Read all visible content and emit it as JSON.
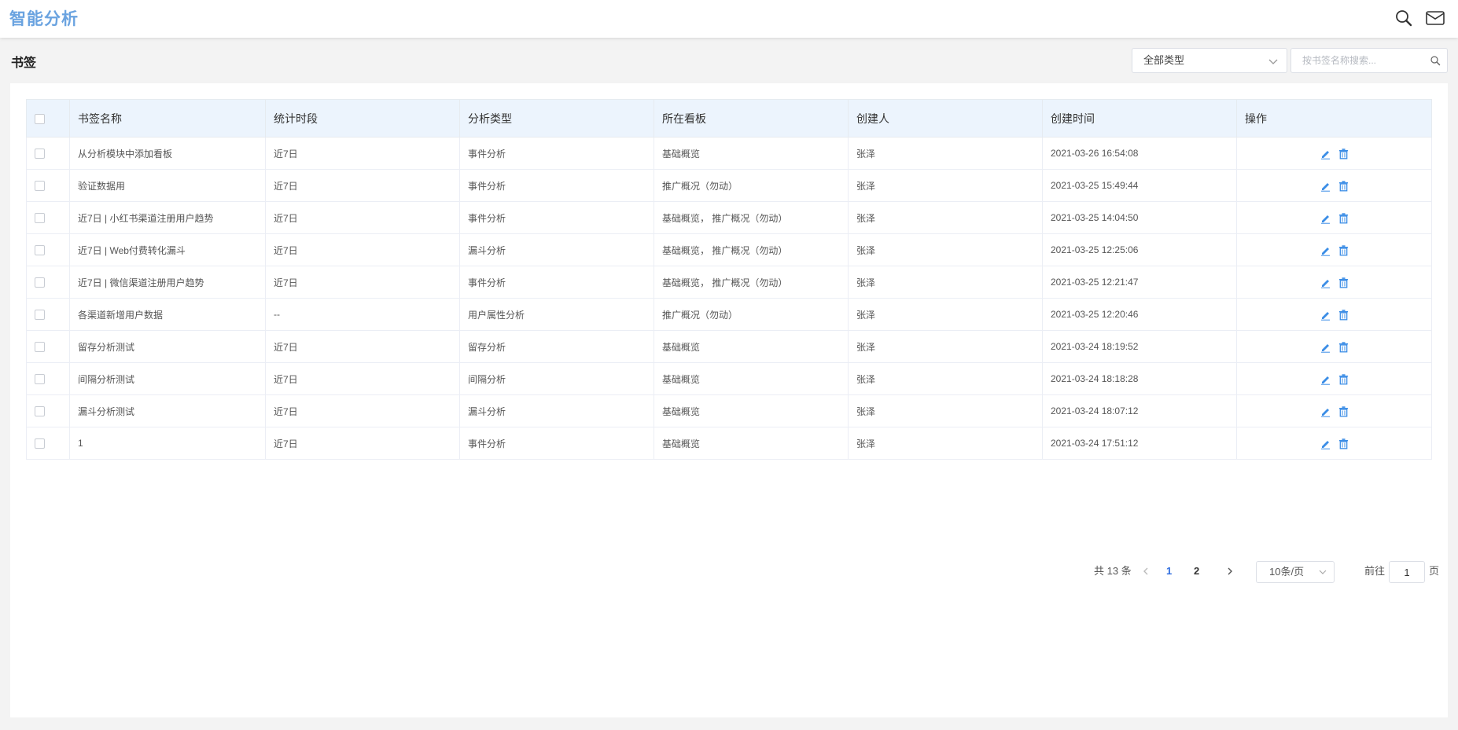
{
  "app": {
    "title": "智能分析"
  },
  "header_icons": [
    "search-icon",
    "mail-icon"
  ],
  "page": {
    "title": "书签"
  },
  "filters": {
    "type_select": {
      "selected": "全部类型",
      "chevron_icon": "chevron-down-icon"
    },
    "search": {
      "placeholder": "按书签名称搜索...",
      "value": "",
      "icon": "search-icon"
    }
  },
  "table": {
    "columns": [
      "",
      "书签名称",
      "统计时段",
      "分析类型",
      "所在看板",
      "创建人",
      "创建时间",
      "操作"
    ],
    "row_actions": [
      "edit-icon",
      "delete-icon"
    ],
    "rows": [
      {
        "name": "从分析模块中添加看板",
        "period": "近7日",
        "type": "事件分析",
        "board": "基础概览",
        "creator": "张泽",
        "created": "2021-03-26 16:54:08"
      },
      {
        "name": "验证数据用",
        "period": "近7日",
        "type": "事件分析",
        "board": "推广概况（勿动）",
        "creator": "张泽",
        "created": "2021-03-25 15:49:44"
      },
      {
        "name": "近7日 | 小红书渠道注册用户趋势",
        "period": "近7日",
        "type": "事件分析",
        "board": "基础概览， 推广概况（勿动）",
        "creator": "张泽",
        "created": "2021-03-25 14:04:50"
      },
      {
        "name": "近7日 | Web付费转化漏斗",
        "period": "近7日",
        "type": "漏斗分析",
        "board": "基础概览， 推广概况（勿动）",
        "creator": "张泽",
        "created": "2021-03-25 12:25:06"
      },
      {
        "name": "近7日 | 微信渠道注册用户趋势",
        "period": "近7日",
        "type": "事件分析",
        "board": "基础概览， 推广概况（勿动）",
        "creator": "张泽",
        "created": "2021-03-25 12:21:47"
      },
      {
        "name": "各渠道新增用户数据",
        "period": "--",
        "type": "用户属性分析",
        "board": "推广概况（勿动）",
        "creator": "张泽",
        "created": "2021-03-25 12:20:46"
      },
      {
        "name": "留存分析测试",
        "period": "近7日",
        "type": "留存分析",
        "board": "基础概览",
        "creator": "张泽",
        "created": "2021-03-24 18:19:52"
      },
      {
        "name": "间隔分析测试",
        "period": "近7日",
        "type": "间隔分析",
        "board": "基础概览",
        "creator": "张泽",
        "created": "2021-03-24 18:18:28"
      },
      {
        "name": "漏斗分析测试",
        "period": "近7日",
        "type": "漏斗分析",
        "board": "基础概览",
        "creator": "张泽",
        "created": "2021-03-24 18:07:12"
      },
      {
        "name": "1",
        "period": "近7日",
        "type": "事件分析",
        "board": "基础概览",
        "creator": "张泽",
        "created": "2021-03-24 17:51:12"
      }
    ]
  },
  "pagination": {
    "total_text": "共 13 条",
    "pages": [
      "1",
      "2"
    ],
    "current_page": "1",
    "page_size": "10条/页",
    "goto_label": "前往",
    "goto_value": "1",
    "goto_suffix": "页"
  },
  "colors": {
    "brand": "#6aa3e0",
    "accent": "#2d6cdf",
    "header_bg": "#ecf4fd",
    "icon_blue": "#3b8de6"
  }
}
